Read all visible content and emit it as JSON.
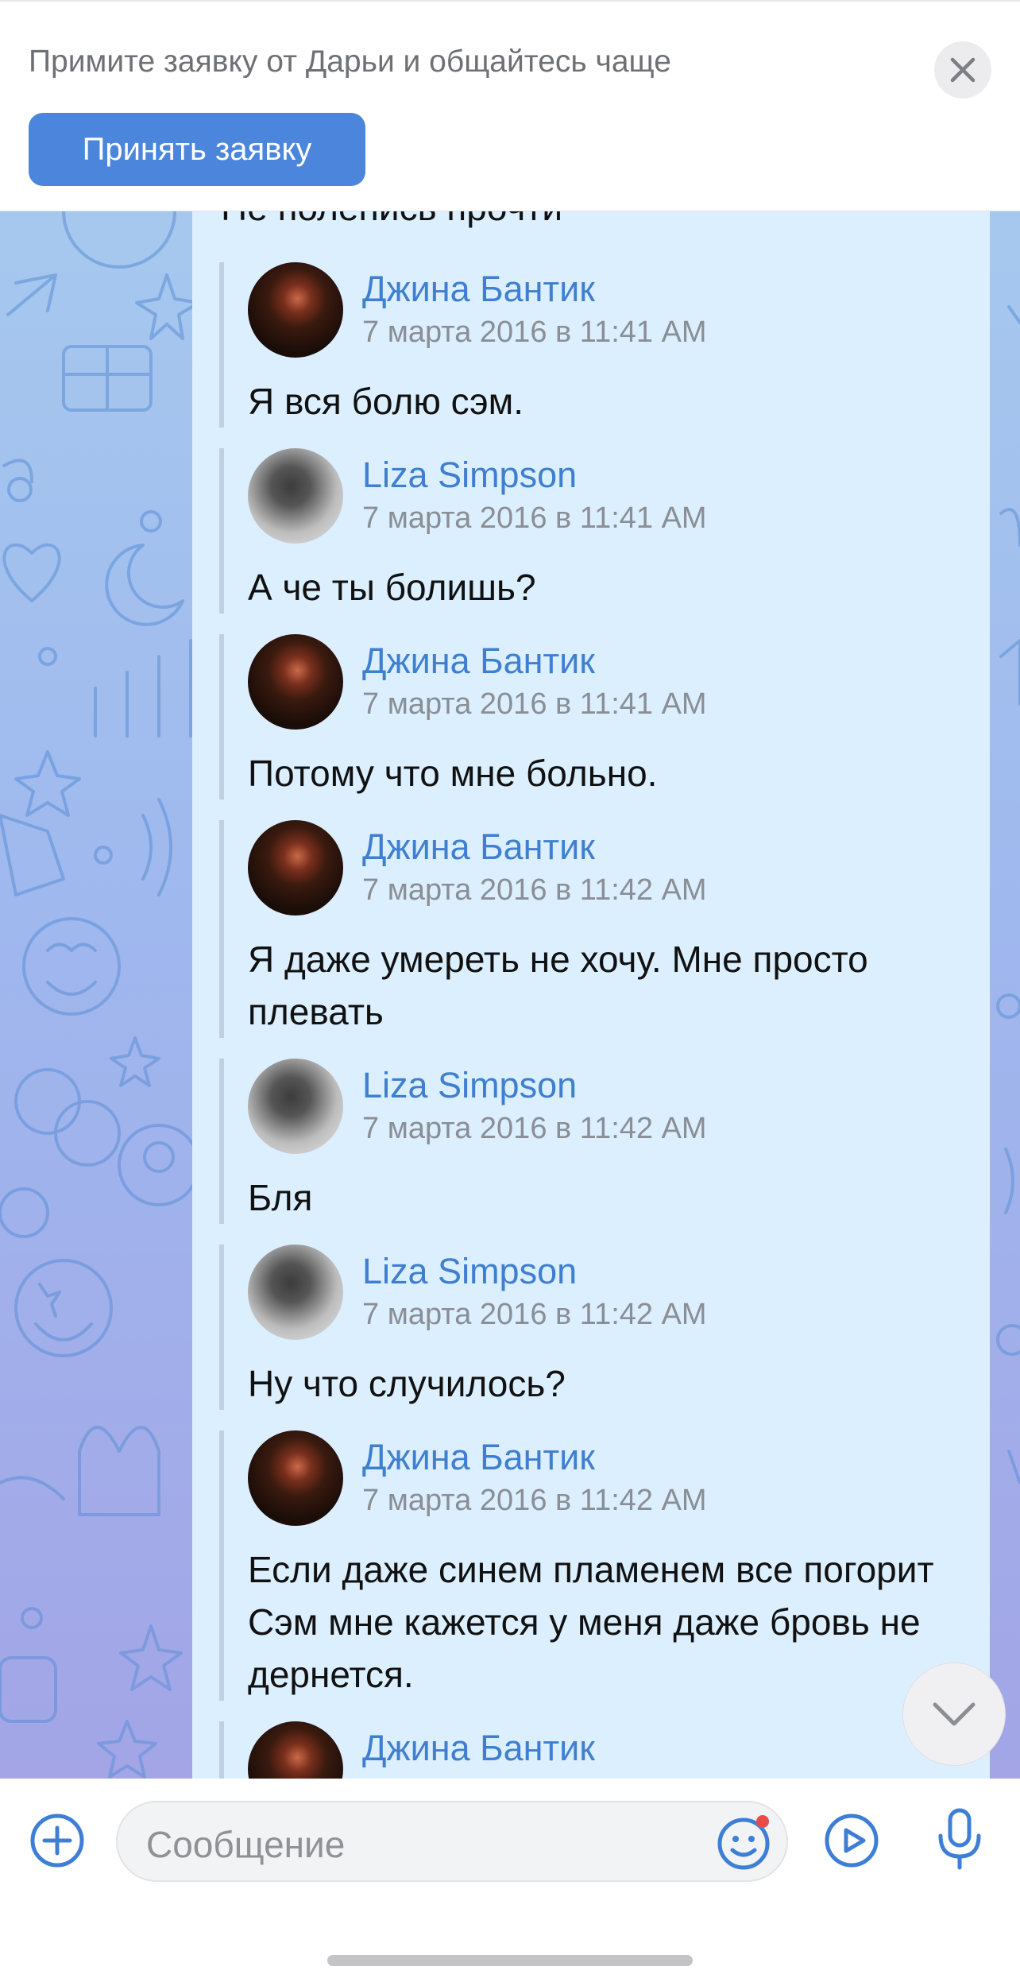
{
  "banner": {
    "text": "Примите заявку от Дарьи и общайтесь чаще",
    "accept_label": "Принять заявку"
  },
  "chat": {
    "cut_off_text": "Не поленись прочти",
    "messages": [
      {
        "author": "Джина Бантик",
        "time": "7 марта 2016 в 11:41 AM",
        "text": "Я вся болю сэм.",
        "avatar": "lips-avatar"
      },
      {
        "author": "Liza Simpson",
        "time": "7 марта 2016 в 11:41 AM",
        "text": "А че ты болишь?",
        "avatar": "girl-avatar"
      },
      {
        "author": "Джина Бантик",
        "time": "7 марта 2016 в 11:41 AM",
        "text": "Потому что мне больно.",
        "avatar": "lips-avatar"
      },
      {
        "author": "Джина Бантик",
        "time": "7 марта 2016 в 11:42 AM",
        "text": "Я даже умереть не хочу. Мне просто плевать",
        "avatar": "lips-avatar"
      },
      {
        "author": "Liza Simpson",
        "time": "7 марта 2016 в 11:42 AM",
        "text": "Бля",
        "avatar": "girl-avatar"
      },
      {
        "author": "Liza Simpson",
        "time": "7 марта 2016 в 11:42 AM",
        "text": "Ну что случилось?",
        "avatar": "girl-avatar"
      },
      {
        "author": "Джина Бантик",
        "time": "7 марта 2016 в 11:42 AM",
        "text": "Если даже синем пламенем все погорит Сэм мне кажется у меня даже бровь не дернется.",
        "avatar": "lips-avatar"
      },
      {
        "author": "Джина Бантик",
        "time": "",
        "text": "",
        "avatar": "lips-avatar"
      }
    ]
  },
  "composer": {
    "placeholder": "Сообщение"
  },
  "colors": {
    "accent": "#4b86dc",
    "name": "#3f7fd0",
    "bubble": "#dcefff",
    "icon": "#3d7fd6"
  }
}
